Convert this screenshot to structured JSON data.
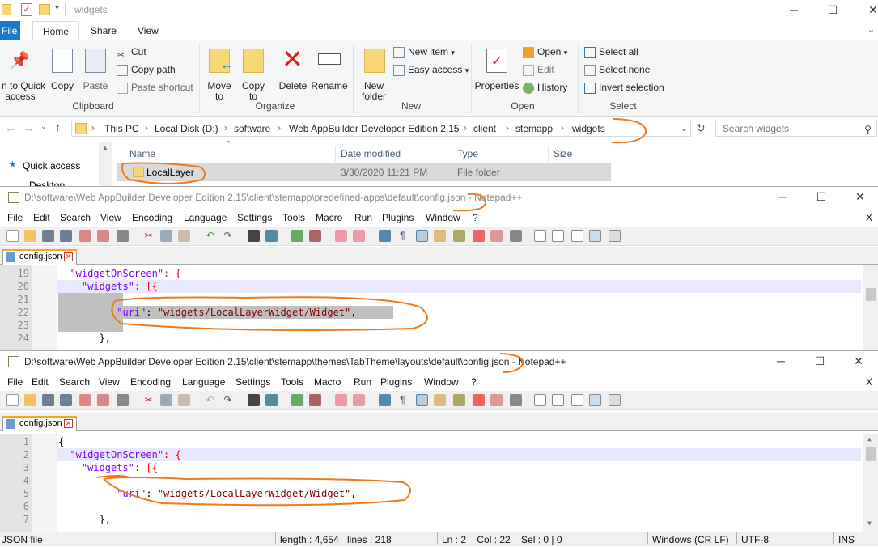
{
  "explorer": {
    "title": "widgets",
    "tabs": {
      "file": "File",
      "home": "Home",
      "share": "Share",
      "view": "View"
    },
    "clipboard": {
      "pin": "n to Quick",
      "pin2": "access",
      "copy": "Copy",
      "paste": "Paste",
      "cut": "Cut",
      "copy_path": "Copy path",
      "paste_shortcut": "Paste shortcut",
      "label": "Clipboard"
    },
    "organize": {
      "move": "Move",
      "move2": "to",
      "copy": "Copy",
      "copy2": "to",
      "delete": "Delete",
      "rename": "Rename",
      "label": "Organize"
    },
    "new": {
      "new_folder": "New",
      "new_folder2": "folder",
      "new_item": "New item",
      "easy_access": "Easy access",
      "label": "New"
    },
    "open": {
      "properties": "Properties",
      "open": "Open",
      "edit": "Edit",
      "history": "History",
      "label": "Open"
    },
    "select": {
      "select_all": "Select all",
      "select_none": "Select none",
      "invert": "Invert selection",
      "label": "Select"
    },
    "breadcrumb": [
      "This PC",
      "Local Disk (D:)",
      "software",
      "Web AppBuilder Developer Edition 2.15",
      "client",
      "stemapp",
      "widgets"
    ],
    "search_placeholder": "Search widgets",
    "columns": {
      "name": "Name",
      "date": "Date modified",
      "type": "Type",
      "size": "Size"
    },
    "nav": {
      "quick_access": "Quick access",
      "desktop": "Desktop"
    },
    "row": {
      "name": "LocalLayer",
      "date": "3/30/2020 11:21 PM",
      "type": "File folder"
    }
  },
  "notepad1": {
    "title": "D:\\software\\Web AppBuilder Developer Edition 2.15\\client\\stemapp\\predefined-apps\\default\\config.json - Notepad++",
    "menu": [
      "File",
      "Edit",
      "Search",
      "View",
      "Encoding",
      "Language",
      "Settings",
      "Tools",
      "Macro",
      "Run",
      "Plugins",
      "Window",
      "?"
    ],
    "close_x": "X",
    "tab": "config.json",
    "lines": [
      {
        "n": "19",
        "indent": "  ",
        "key": "\"widgetOnScreen\"",
        "rest": ": {"
      },
      {
        "n": "20",
        "indent": "    ",
        "key": "\"widgets\"",
        "rest": ": [{"
      },
      {
        "n": "21",
        "indent": "",
        "key": "",
        "rest": ""
      },
      {
        "n": "22",
        "indent": "          ",
        "key": "\"uri\"",
        "rest": ": ",
        "val": "\"widgets/LocalLayerWidget/Widget\"",
        "tail": ","
      },
      {
        "n": "23",
        "indent": "",
        "key": "",
        "rest": ""
      },
      {
        "n": "24",
        "indent": "       ",
        "key": "",
        "rest": "},"
      }
    ]
  },
  "notepad2": {
    "title": "D:\\software\\Web AppBuilder Developer Edition 2.15\\client\\stemapp\\themes\\TabTheme\\layouts\\default\\config.json - Notepad++",
    "menu": [
      "File",
      "Edit",
      "Search",
      "View",
      "Encoding",
      "Language",
      "Settings",
      "Tools",
      "Macro",
      "Run",
      "Plugins",
      "Window",
      "?"
    ],
    "close_x": "X",
    "tab": "config.json",
    "lines": [
      {
        "n": "1",
        "indent": "",
        "key": "",
        "rest": "{"
      },
      {
        "n": "2",
        "indent": "  ",
        "key": "\"widgetOnScreen\"",
        "rest": ": {"
      },
      {
        "n": "3",
        "indent": "    ",
        "key": "\"widgets\"",
        "rest": ": [{"
      },
      {
        "n": "4",
        "indent": "",
        "key": "",
        "rest": ""
      },
      {
        "n": "5",
        "indent": "          ",
        "key": "\"uri\"",
        "rest": ": ",
        "val": "\"widgets/LocalLayerWidget/Widget\"",
        "tail": ","
      },
      {
        "n": "6",
        "indent": "",
        "key": "",
        "rest": ""
      },
      {
        "n": "7",
        "indent": "       ",
        "key": "",
        "rest": "},"
      }
    ]
  },
  "status": {
    "type": "JSON file",
    "length": "length : 4,654",
    "lines": "lines : 218",
    "pos": "Ln : 2    Col : 22    Sel : 0 | 0",
    "eol": "Windows (CR LF)",
    "enc": "UTF-8",
    "ins": "INS"
  },
  "colors": {
    "accent": "#1979ca",
    "annotation": "#f07a1a",
    "selection": "#c0c0c0",
    "key": "#8000ff",
    "string": "#800000"
  }
}
